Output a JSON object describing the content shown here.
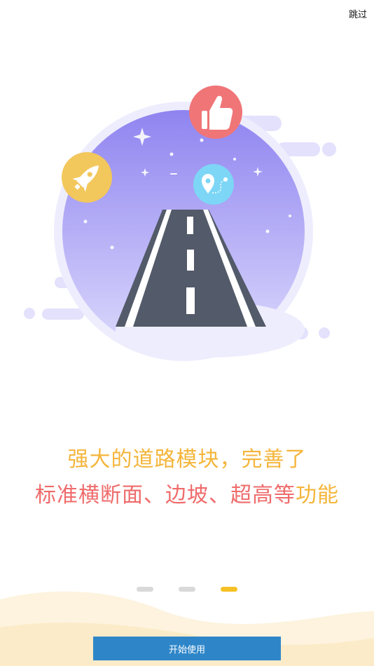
{
  "header": {
    "skip_label": "跳过"
  },
  "slide": {
    "title_line1": "强大的道路模块，完善了",
    "title_line2_main": "标准横断面、边坡、超高等",
    "title_line2_tail": "功能"
  },
  "pager": {
    "total": 3,
    "active": 3
  },
  "footer": {
    "start_label": "开始使用"
  },
  "colors": {
    "accent_gold": "#f4b53a",
    "accent_red": "#ef6b6b",
    "button_blue": "#2e86c9",
    "dot_active": "#f6c126",
    "dot_inactive": "#d9d9d9",
    "circle_top": "#8f84f0",
    "circle_bottom": "#d8d6fb"
  },
  "icons": [
    "rocket-icon",
    "thumbs-up-icon",
    "location-route-icon",
    "road-icon",
    "sparkle-icon"
  ]
}
